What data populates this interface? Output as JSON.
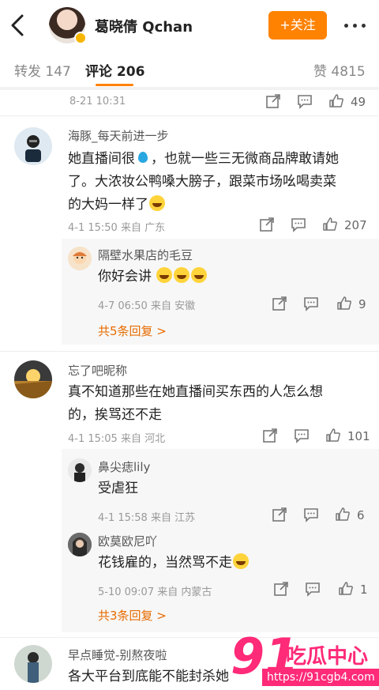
{
  "header": {
    "user_name": "葛晓倩 Qchan",
    "follow_label": "+关注"
  },
  "tabs": {
    "repost_label": "转发 147",
    "comment_label": "评论 206",
    "like_label": "赞 4815"
  },
  "top_item": {
    "time": "8-21 10:31",
    "likes": "49"
  },
  "comments": [
    {
      "user": "海豚_每天前进一步",
      "lines": [
        "她直播间很",
        "，也就一些三无微商品牌敢请她",
        "了。大浓妆公鸭嗓大膀子，跟菜市场吆喝卖菜",
        "的大妈一样了"
      ],
      "meta": "4-1 15:50  来自 广东",
      "likes": "207",
      "replies": [
        {
          "user": "隔壁水果店的毛豆",
          "text": "你好会讲",
          "meta": "4-7 06:50  来自 安徽",
          "likes": "9"
        }
      ],
      "more": "共5条回复 >"
    },
    {
      "user": "忘了吧昵称",
      "lines": [
        "真不知道那些在她直播间买东西的人怎么想",
        "的，挨骂还不走"
      ],
      "meta": "4-1 15:05  来自 河北",
      "likes": "101",
      "replies": [
        {
          "user": "鼻尖痣lily",
          "text": "受虐狂",
          "meta": "4-1 15:58  来自 江苏",
          "likes": "6"
        },
        {
          "user": "欧莫欧尼吖",
          "text": "花钱雇的，当然骂不走",
          "meta": "5-10 09:07  来自 内蒙古",
          "likes": "1"
        }
      ],
      "more": "共3条回复 >"
    },
    {
      "user": "早点睡觉-别熬夜啦",
      "lines": [
        "各大平台到底能不能封杀她"
      ]
    }
  ],
  "watermark": {
    "number": "91",
    "text": "吃瓜中心",
    "url": "https://91cgb4.com"
  },
  "colors": {
    "accent": "#ff8200",
    "link": "#e86b00",
    "watermark": "#ff2a78"
  }
}
